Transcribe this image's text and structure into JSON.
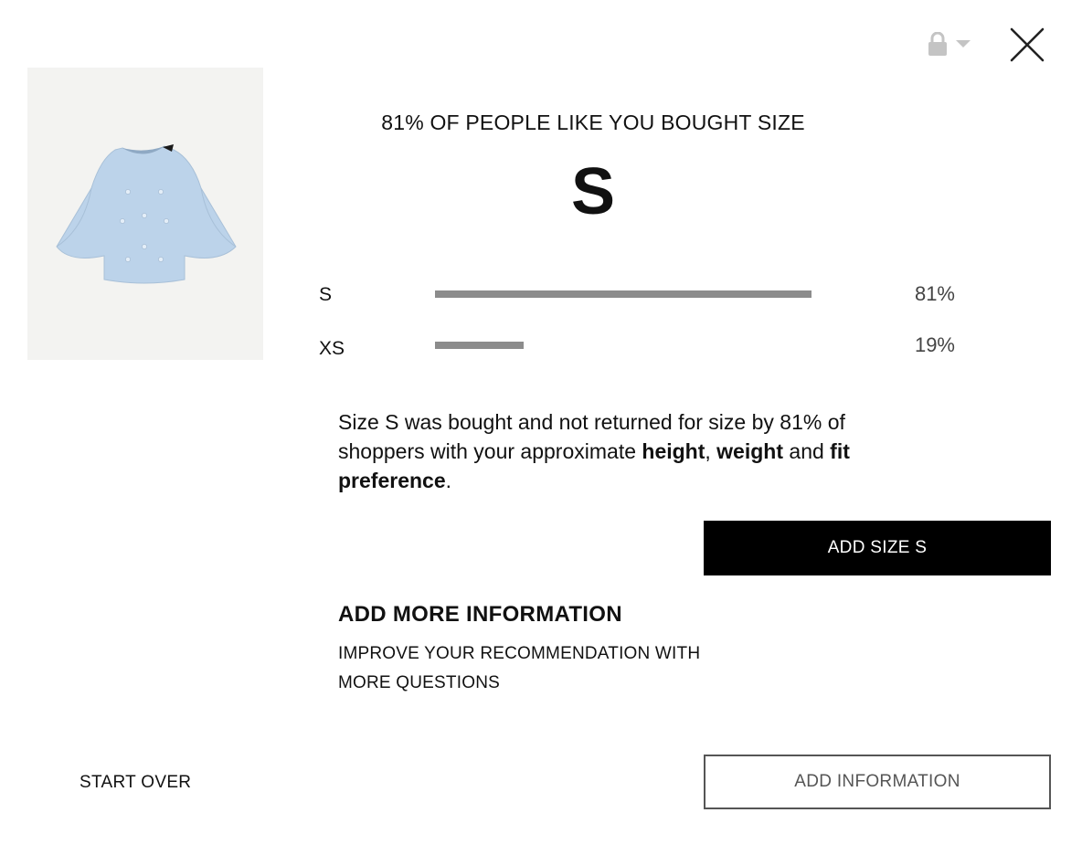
{
  "header": {
    "lock_icon": "lock-icon",
    "dropdown_icon": "chevron-down-icon",
    "close_icon": "close-icon"
  },
  "product": {
    "image_icon": "blouse-image",
    "garment_color": "#bcd3ea"
  },
  "recommendation": {
    "headline": "81% OF PEOPLE LIKE YOU BOUGHT SIZE",
    "size": "S",
    "distribution": [
      {
        "label": "S",
        "percent_text": "81%",
        "fraction": 0.81
      },
      {
        "label": "XS",
        "percent_text": "19%",
        "fraction": 0.19
      }
    ],
    "explanation": {
      "intro": "Size S was bought and not returned for size by 81% of shoppers with your approximate ",
      "height": "height",
      "comma": ", ",
      "weight": "weight",
      "and": " and ",
      "fit": "fit preference",
      "period": "."
    },
    "add_size_label": "ADD SIZE S"
  },
  "more_info": {
    "title": "ADD MORE INFORMATION",
    "subtitle": "IMPROVE YOUR RECOMMENDATION WITH MORE QUESTIONS"
  },
  "footer": {
    "start_over_label": "START OVER",
    "add_info_label": "ADD INFORMATION"
  },
  "colors": {
    "bar": "#8c8c8c",
    "primary_button": "#000000",
    "image_background": "#f3f3f1"
  }
}
